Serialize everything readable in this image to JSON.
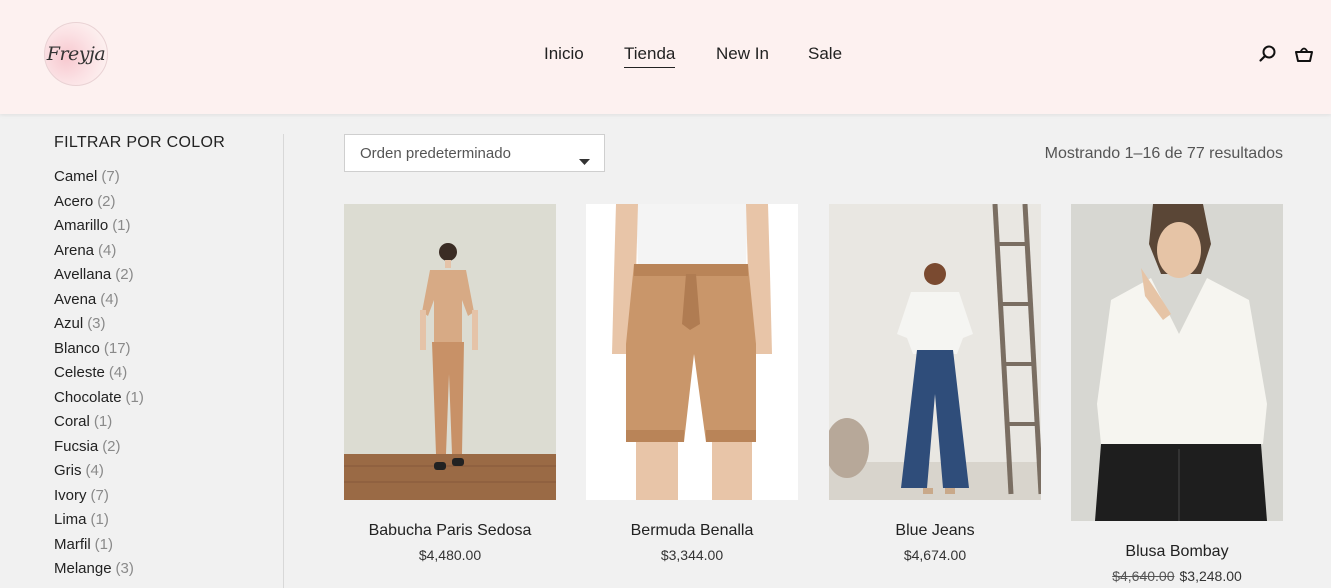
{
  "brand": {
    "logo_text": "Freyja"
  },
  "nav": {
    "items": [
      {
        "label": "Inicio",
        "active": false
      },
      {
        "label": "Tienda",
        "active": true
      },
      {
        "label": "New In",
        "active": false
      },
      {
        "label": "Sale",
        "active": false
      }
    ]
  },
  "header_icons": [
    "search-icon",
    "basket-icon"
  ],
  "filter": {
    "title": "FILTRAR POR COLOR",
    "colors": [
      {
        "name": "Camel",
        "count": "(7)"
      },
      {
        "name": "Acero",
        "count": "(2)"
      },
      {
        "name": "Amarillo",
        "count": "(1)"
      },
      {
        "name": "Arena",
        "count": "(4)"
      },
      {
        "name": "Avellana",
        "count": "(2)"
      },
      {
        "name": "Avena",
        "count": "(4)"
      },
      {
        "name": "Azul",
        "count": "(3)"
      },
      {
        "name": "Blanco",
        "count": "(17)"
      },
      {
        "name": "Celeste",
        "count": "(4)"
      },
      {
        "name": "Chocolate",
        "count": "(1)"
      },
      {
        "name": "Coral",
        "count": "(1)"
      },
      {
        "name": "Fucsia",
        "count": "(2)"
      },
      {
        "name": "Gris",
        "count": "(4)"
      },
      {
        "name": "Ivory",
        "count": "(7)"
      },
      {
        "name": "Lima",
        "count": "(1)"
      },
      {
        "name": "Marfil",
        "count": "(1)"
      },
      {
        "name": "Melange",
        "count": "(3)"
      }
    ]
  },
  "toolbar": {
    "sort_value": "Orden predeterminado",
    "results_text": "Mostrando 1–16 de 77 resultados"
  },
  "products": [
    {
      "name": "Babucha Paris Sedosa",
      "price": "$4,480.00",
      "old_price": ""
    },
    {
      "name": "Bermuda Benalla",
      "price": "$3,344.00",
      "old_price": ""
    },
    {
      "name": "Blue Jeans",
      "price": "$4,674.00",
      "old_price": ""
    },
    {
      "name": "Blusa Bombay",
      "price": "$3,248.00",
      "old_price": "$4,640.00"
    }
  ],
  "colors": {
    "header_bg": "#fdf1f0",
    "page_bg": "#f1f1f1",
    "accent": "#222222"
  }
}
